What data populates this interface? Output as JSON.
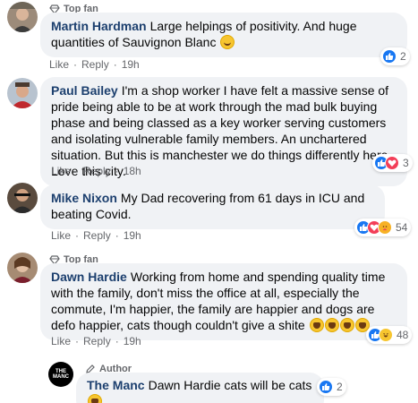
{
  "comments": [
    {
      "badge": "Top fan",
      "name": "Martin Hardman",
      "text": "Large helpings of positivity. And huge quantities of Sauvignon Blanc",
      "actions": {
        "like": "Like",
        "reply": "Reply",
        "time": "19h"
      },
      "reaction_count": "2"
    },
    {
      "name": "Paul Bailey",
      "text": "I'm a shop worker I have felt a massive sense of pride being able to be at work through the mad bulk buying phase and being classed as a key worker serving customers and isolating vulnerable family members. An unchartered situation. But this is manchester we do things differently here. Love this city.",
      "actions": {
        "like": "Like",
        "reply": "Reply",
        "time": "18h"
      },
      "reaction_count": "3"
    },
    {
      "name": "Mike Nixon",
      "text": "My Dad recovering from 61 days in ICU and beating Covid.",
      "actions": {
        "like": "Like",
        "reply": "Reply",
        "time": "19h"
      },
      "reaction_count": "54"
    },
    {
      "badge": "Top fan",
      "name": "Dawn Hardie",
      "text": "Working from home and spending quality time with the family, don't miss the office at all, especially the commute, I'm happier, the family are happier and dogs are defo happier, cats though couldn't give a shite",
      "actions": {
        "like": "Like",
        "reply": "Reply",
        "time": "19h"
      },
      "reaction_count": "48"
    },
    {
      "badge": "Author",
      "name": "The Manc",
      "text": "Dawn Hardie cats will be cats",
      "avatar_text": "THE MANC",
      "reaction_count": "2"
    }
  ],
  "colors": {
    "bubble": "#f0f2f5",
    "name": "#1c3f6e",
    "meta": "#65676b",
    "like": "#1877f2",
    "love": "#f33e58",
    "haha": "#f7c52f"
  }
}
